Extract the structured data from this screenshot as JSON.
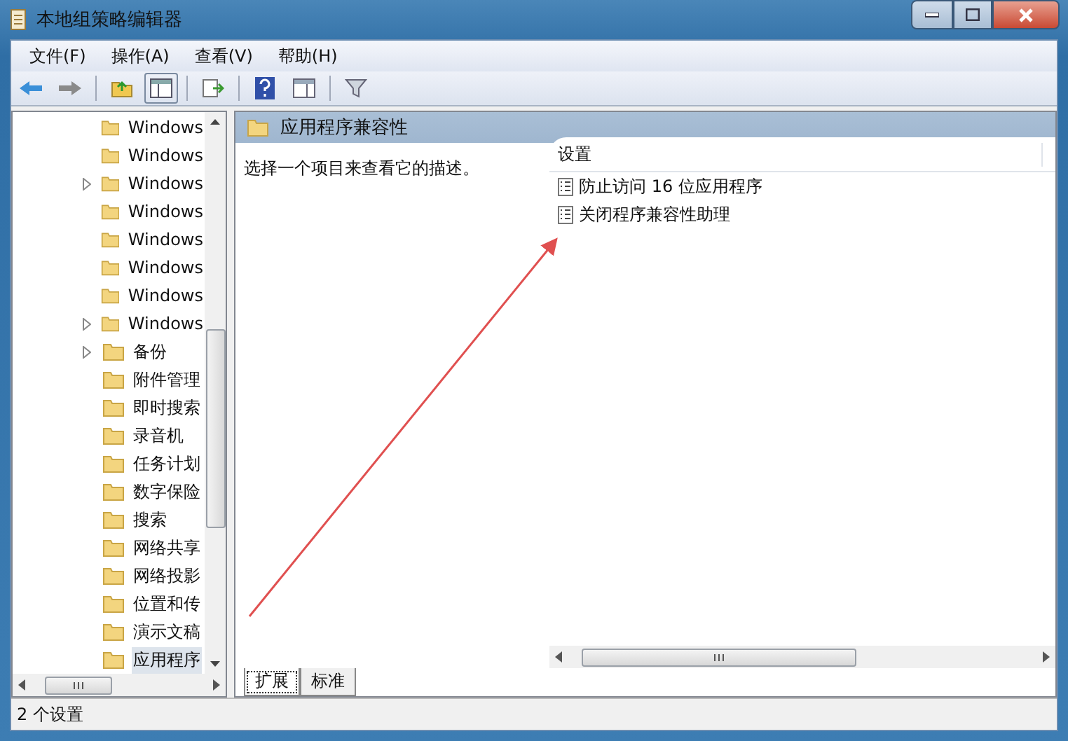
{
  "window": {
    "title": "本地组策略编辑器"
  },
  "menu": [
    "文件(F)",
    "操作(A)",
    "查看(V)",
    "帮助(H)"
  ],
  "tree": {
    "items": [
      {
        "label": "Windows",
        "expandable": false,
        "selected": false
      },
      {
        "label": "Windows",
        "expandable": false,
        "selected": false
      },
      {
        "label": "Windows",
        "expandable": true,
        "selected": false
      },
      {
        "label": "Windows",
        "expandable": false,
        "selected": false
      },
      {
        "label": "Windows",
        "expandable": false,
        "selected": false
      },
      {
        "label": "Windows",
        "expandable": false,
        "selected": false
      },
      {
        "label": "Windows",
        "expandable": false,
        "selected": false
      },
      {
        "label": "Windows",
        "expandable": true,
        "selected": false
      },
      {
        "label": "备份",
        "expandable": true,
        "selected": false
      },
      {
        "label": "附件管理",
        "expandable": false,
        "selected": false
      },
      {
        "label": "即时搜索",
        "expandable": false,
        "selected": false
      },
      {
        "label": "录音机",
        "expandable": false,
        "selected": false
      },
      {
        "label": "任务计划",
        "expandable": false,
        "selected": false
      },
      {
        "label": "数字保险",
        "expandable": false,
        "selected": false
      },
      {
        "label": "搜索",
        "expandable": false,
        "selected": false
      },
      {
        "label": "网络共享",
        "expandable": false,
        "selected": false
      },
      {
        "label": "网络投影",
        "expandable": false,
        "selected": false
      },
      {
        "label": "位置和传",
        "expandable": false,
        "selected": false
      },
      {
        "label": "演示文稿",
        "expandable": false,
        "selected": false
      },
      {
        "label": "应用程序",
        "expandable": false,
        "selected": true
      }
    ]
  },
  "details": {
    "folder_title": "应用程序兼容性",
    "description": "选择一个项目来查看它的描述。",
    "columns": [
      "设置"
    ],
    "rows": [
      "防止访问 16 位应用程序",
      "关闭程序兼容性助理"
    ]
  },
  "tabs": [
    {
      "label": "扩展",
      "selected": true
    },
    {
      "label": "标准",
      "selected": false
    }
  ],
  "status_bar": "2 个设置"
}
